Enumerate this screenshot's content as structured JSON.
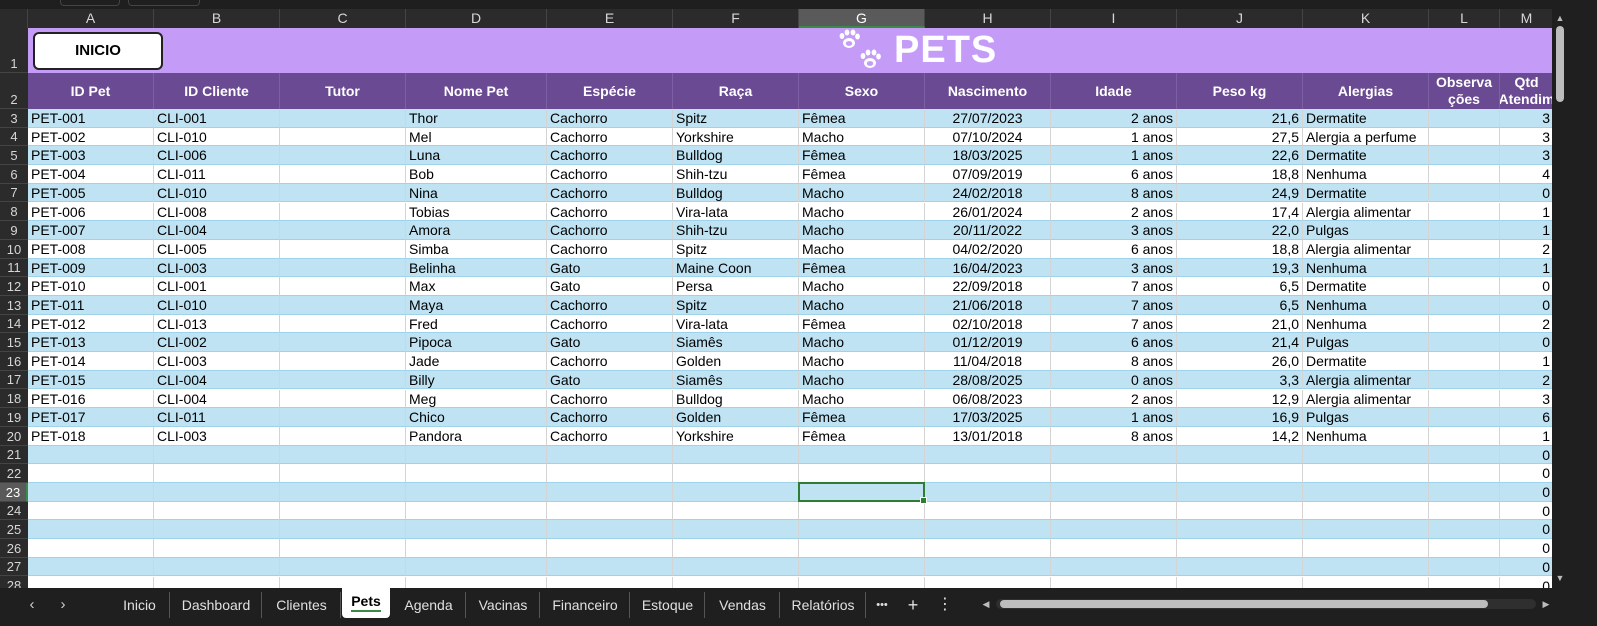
{
  "columns": [
    "A",
    "B",
    "C",
    "D",
    "E",
    "F",
    "G",
    "H",
    "I",
    "J",
    "K",
    "L",
    "M"
  ],
  "selected_column": "G",
  "row_numbers": [
    "1",
    "2",
    "3",
    "4",
    "5",
    "6",
    "7",
    "8",
    "9",
    "10",
    "11",
    "12",
    "13",
    "14",
    "15",
    "16",
    "17",
    "18",
    "19",
    "20",
    "21",
    "22",
    "23",
    "24",
    "25",
    "26",
    "27",
    "28"
  ],
  "selected_row": "23",
  "inicio_button": "INICIO",
  "page_title": "PETS",
  "title_icon": "paw-prints-icon",
  "headers": [
    "ID Pet",
    "ID Cliente",
    "Tutor",
    "Nome Pet",
    "Espécie",
    "Raça",
    "Sexo",
    "Nascimento",
    "Idade",
    "Peso kg",
    "Alergias",
    "Observa ções",
    "Qtd Atendim"
  ],
  "pets": [
    [
      "PET-001",
      "CLI-001",
      "",
      "Thor",
      "Cachorro",
      "Spitz",
      "Fêmea",
      "27/07/2023",
      "2 anos",
      "21,6",
      "Dermatite",
      "",
      "3"
    ],
    [
      "PET-002",
      "CLI-010",
      "",
      "Mel",
      "Cachorro",
      "Yorkshire",
      "Macho",
      "07/10/2024",
      "1 anos",
      "27,5",
      "Alergia a perfume",
      "",
      "3"
    ],
    [
      "PET-003",
      "CLI-006",
      "",
      "Luna",
      "Cachorro",
      "Bulldog",
      "Fêmea",
      "18/03/2025",
      "1 anos",
      "22,6",
      "Dermatite",
      "",
      "3"
    ],
    [
      "PET-004",
      "CLI-011",
      "",
      "Bob",
      "Cachorro",
      "Shih-tzu",
      "Fêmea",
      "07/09/2019",
      "6 anos",
      "18,8",
      "Nenhuma",
      "",
      "4"
    ],
    [
      "PET-005",
      "CLI-010",
      "",
      "Nina",
      "Cachorro",
      "Bulldog",
      "Macho",
      "24/02/2018",
      "8 anos",
      "24,9",
      "Dermatite",
      "",
      "0"
    ],
    [
      "PET-006",
      "CLI-008",
      "",
      "Tobias",
      "Cachorro",
      "Vira-lata",
      "Macho",
      "26/01/2024",
      "2 anos",
      "17,4",
      "Alergia alimentar",
      "",
      "1"
    ],
    [
      "PET-007",
      "CLI-004",
      "",
      "Amora",
      "Cachorro",
      "Shih-tzu",
      "Macho",
      "20/11/2022",
      "3 anos",
      "22,0",
      "Pulgas",
      "",
      "1"
    ],
    [
      "PET-008",
      "CLI-005",
      "",
      "Simba",
      "Cachorro",
      "Spitz",
      "Macho",
      "04/02/2020",
      "6 anos",
      "18,8",
      "Alergia alimentar",
      "",
      "2"
    ],
    [
      "PET-009",
      "CLI-003",
      "",
      "Belinha",
      "Gato",
      "Maine Coon",
      "Fêmea",
      "16/04/2023",
      "3 anos",
      "19,3",
      "Nenhuma",
      "",
      "1"
    ],
    [
      "PET-010",
      "CLI-001",
      "",
      "Max",
      "Gato",
      "Persa",
      "Macho",
      "22/09/2018",
      "7 anos",
      "6,5",
      "Dermatite",
      "",
      "0"
    ],
    [
      "PET-011",
      "CLI-010",
      "",
      "Maya",
      "Cachorro",
      "Spitz",
      "Macho",
      "21/06/2018",
      "7 anos",
      "6,5",
      "Nenhuma",
      "",
      "0"
    ],
    [
      "PET-012",
      "CLI-013",
      "",
      "Fred",
      "Cachorro",
      "Vira-lata",
      "Fêmea",
      "02/10/2018",
      "7 anos",
      "21,0",
      "Nenhuma",
      "",
      "2"
    ],
    [
      "PET-013",
      "CLI-002",
      "",
      "Pipoca",
      "Gato",
      "Siamês",
      "Macho",
      "01/12/2019",
      "6 anos",
      "21,4",
      "Pulgas",
      "",
      "0"
    ],
    [
      "PET-014",
      "CLI-003",
      "",
      "Jade",
      "Cachorro",
      "Golden",
      "Macho",
      "11/04/2018",
      "8 anos",
      "26,0",
      "Dermatite",
      "",
      "1"
    ],
    [
      "PET-015",
      "CLI-004",
      "",
      "Billy",
      "Gato",
      "Siamês",
      "Macho",
      "28/08/2025",
      "0 anos",
      "3,3",
      "Alergia alimentar",
      "",
      "2"
    ],
    [
      "PET-016",
      "CLI-004",
      "",
      "Meg",
      "Cachorro",
      "Bulldog",
      "Macho",
      "06/08/2023",
      "2 anos",
      "12,9",
      "Alergia alimentar",
      "",
      "3"
    ],
    [
      "PET-017",
      "CLI-011",
      "",
      "Chico",
      "Cachorro",
      "Golden",
      "Fêmea",
      "17/03/2025",
      "1 anos",
      "16,9",
      "Pulgas",
      "",
      "6"
    ],
    [
      "PET-018",
      "CLI-003",
      "",
      "Pandora",
      "Cachorro",
      "Yorkshire",
      "Fêmea",
      "13/01/2018",
      "8 anos",
      "14,2",
      "Nenhuma",
      "",
      "1"
    ],
    [
      "",
      "",
      "",
      "",
      "",
      "",
      "",
      "",
      "",
      "",
      "",
      "",
      "0"
    ],
    [
      "",
      "",
      "",
      "",
      "",
      "",
      "",
      "",
      "",
      "",
      "",
      "",
      "0"
    ],
    [
      "",
      "",
      "",
      "",
      "",
      "",
      "",
      "",
      "",
      "",
      "",
      "",
      "0"
    ],
    [
      "",
      "",
      "",
      "",
      "",
      "",
      "",
      "",
      "",
      "",
      "",
      "",
      "0"
    ],
    [
      "",
      "",
      "",
      "",
      "",
      "",
      "",
      "",
      "",
      "",
      "",
      "",
      "0"
    ],
    [
      "",
      "",
      "",
      "",
      "",
      "",
      "",
      "",
      "",
      "",
      "",
      "",
      "0"
    ],
    [
      "",
      "",
      "",
      "",
      "",
      "",
      "",
      "",
      "",
      "",
      "",
      "",
      "0"
    ],
    [
      "",
      "",
      "",
      "",
      "",
      "",
      "",
      "",
      "",
      "",
      "",
      "",
      "0"
    ]
  ],
  "sheet_tabs": [
    "Inicio",
    "Dashboard",
    "Clientes",
    "Pets",
    "Agenda",
    "Vacinas",
    "Financeiro",
    "Estoque",
    "Vendas",
    "Relatórios"
  ],
  "active_tab": "Pets",
  "tabbar_controls": {
    "prev": "‹",
    "next": "›",
    "more": "•••",
    "add": "+",
    "options": "⋮"
  },
  "colors": {
    "title_band": "#c49cf7",
    "header_band": "#6a4a93",
    "stripe": "#bfe3f3",
    "white": "#ffffff"
  }
}
